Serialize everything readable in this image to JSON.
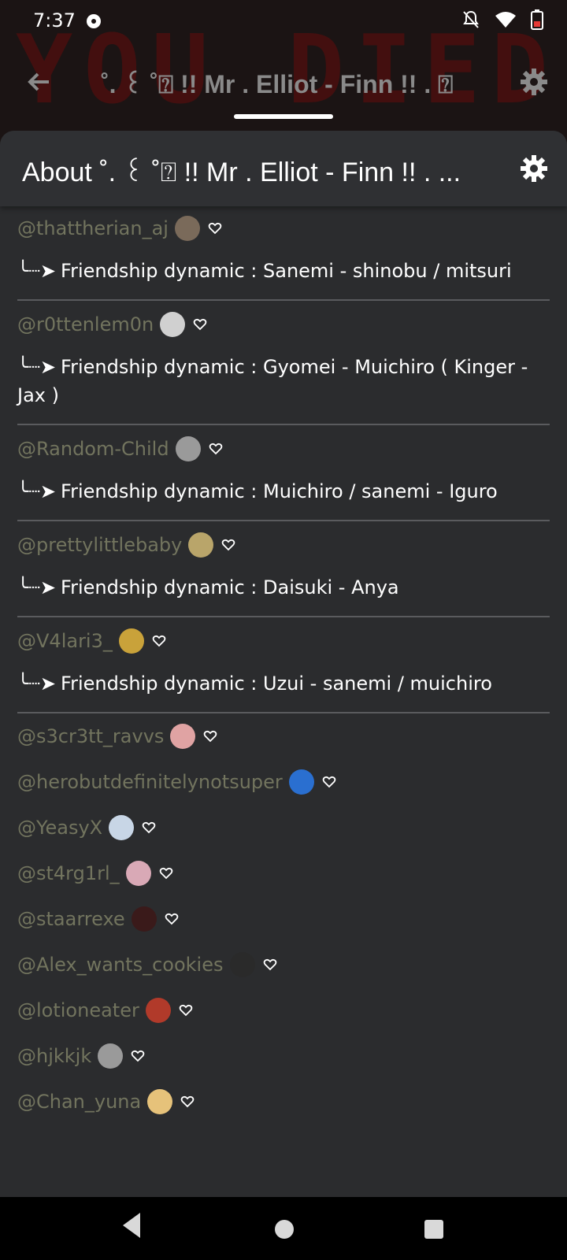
{
  "status": {
    "time": "7:37"
  },
  "background_text": "YOU DIED!",
  "app_bar": {
    "title": "˚. ꒰ ˚⍰ !! Mr . Elliot - Finn !! . ⍰"
  },
  "sheet": {
    "title": "About ˚. ꒰ ˚⍰ !! Mr . Elliot - Finn !! .  ..."
  },
  "entries": [
    {
      "user": "@thattherian_aj",
      "avatar_color": "#7a6a5a",
      "desc": "Friendship dynamic : Sanemi - shinobu / mitsuri"
    },
    {
      "user": "@r0ttenlem0n",
      "avatar_color": "#d0d0d0",
      "desc": "Friendship dynamic : Gyomei - Muichiro ( Kinger - Jax )"
    },
    {
      "user": "@Random-Child",
      "avatar_color": "#9a9a9a",
      "desc": "Friendship dynamic : Muichiro / sanemi - Iguro"
    },
    {
      "user": "@prettylittlebaby",
      "avatar_color": "#b9a56a",
      "desc": "Friendship dynamic : Daisuki - Anya"
    },
    {
      "user": "@V4lari3_",
      "avatar_color": "#c9a23a",
      "desc": "Friendship dynamic : Uzui - sanemi / muichiro"
    }
  ],
  "users": [
    {
      "user": "@s3cr3tt_ravvs",
      "avatar_color": "#e0a3a3"
    },
    {
      "user": "@herobutdefinitelynotsuper",
      "avatar_color": "#2a6fd0"
    },
    {
      "user": "@YeasyX",
      "avatar_color": "#c8d6e6"
    },
    {
      "user": "@st4rg1rl_",
      "avatar_color": "#d9a9b6"
    },
    {
      "user": "@staarrexe",
      "avatar_color": "#3a1a1a"
    },
    {
      "user": "@Alex_wants_cookies",
      "avatar_color": "#2a2a2a"
    },
    {
      "user": "@lotioneater",
      "avatar_color": "#b13a2a"
    },
    {
      "user": "@hjkkjk",
      "avatar_color": "#9a9a9a"
    },
    {
      "user": "@Chan_yuna",
      "avatar_color": "#e6c27a"
    }
  ],
  "arrow_glyph": "╰┈➤"
}
